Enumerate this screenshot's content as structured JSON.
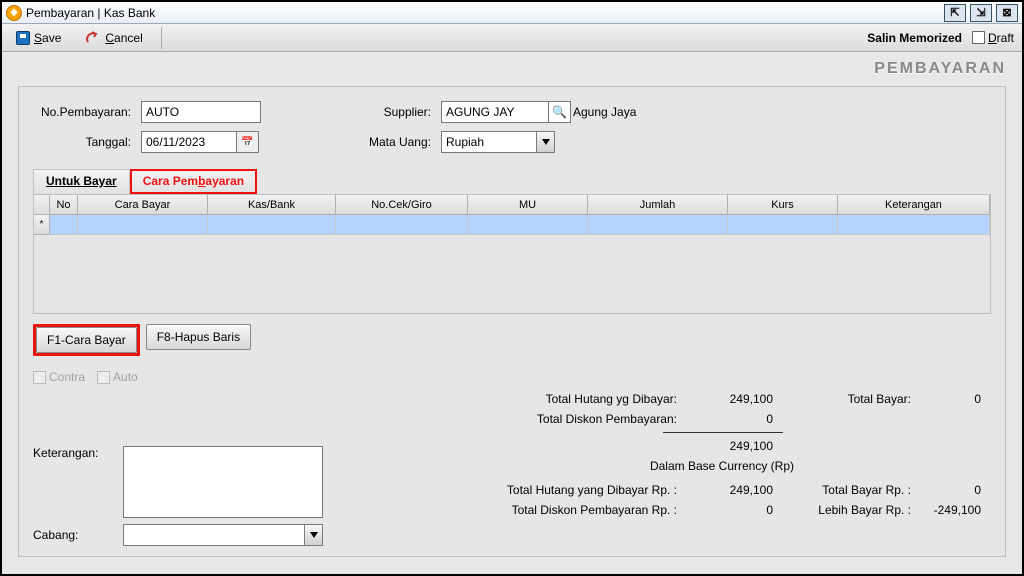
{
  "window": {
    "title": "Pembayaran | Kas Bank"
  },
  "toolbar": {
    "save": "Save",
    "cancel": "Cancel",
    "memorized": "Salin Memorized",
    "draft": "Draft"
  },
  "heading": "PEMBAYARAN",
  "form": {
    "no_label": "No.Pembayaran:",
    "no_value": "AUTO",
    "tanggal_label": "Tanggal:",
    "tanggal_value": "06/11/2023",
    "supplier_label": "Supplier:",
    "supplier_value": "AGUNG JAY",
    "supplier_name": "Agung Jaya",
    "mata_uang_label": "Mata Uang:",
    "mata_uang_value": "Rupiah"
  },
  "tabs": {
    "untuk_bayar": "Untuk Bayar",
    "cara_pembayaran": "Cara Pembayaran"
  },
  "grid": {
    "headers": {
      "no": "No",
      "cara_bayar": "Cara Bayar",
      "kas_bank": "Kas/Bank",
      "no_cek": "No.Cek/Giro",
      "mu": "MU",
      "jumlah": "Jumlah",
      "kurs": "Kurs",
      "keterangan": "Keterangan"
    },
    "row_marker": "*"
  },
  "buttons": {
    "f1": "F1-Cara Bayar",
    "f8": "F8-Hapus Baris"
  },
  "checks": {
    "contra": "Contra",
    "auto": "Auto"
  },
  "bottom_left": {
    "keterangan_label": "Keterangan:",
    "cabang_label": "Cabang:"
  },
  "summary": {
    "total_hutang_label": "Total Hutang yg Dibayar:",
    "total_hutang_value": "249,100",
    "total_diskon_label": "Total Diskon Pembayaran:",
    "total_diskon_value": "0",
    "subtotal_value": "249,100",
    "base_currency_note": "Dalam Base Currency (Rp)",
    "total_hutang_rp_label": "Total Hutang yang Dibayar Rp. :",
    "total_hutang_rp_value": "249,100",
    "total_diskon_rp_label": "Total Diskon Pembayaran Rp. :",
    "total_diskon_rp_value": "0",
    "total_bayar_label": "Total Bayar:",
    "total_bayar_value": "0",
    "total_bayar_rp_label": "Total Bayar Rp. :",
    "total_bayar_rp_value": "0",
    "lebih_bayar_label": "Lebih Bayar Rp. :",
    "lebih_bayar_value": "-249,100"
  }
}
